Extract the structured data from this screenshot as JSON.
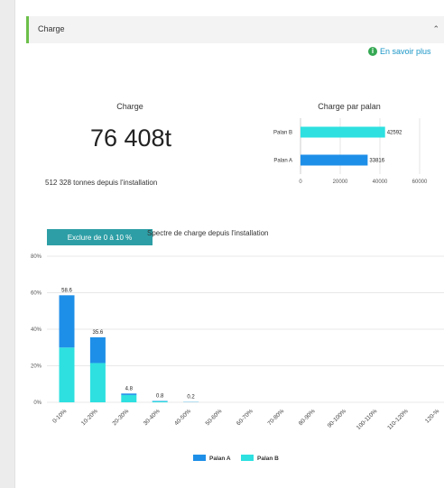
{
  "panel": {
    "title": "Charge"
  },
  "info_link": {
    "label": "En savoir plus"
  },
  "kpi": {
    "title": "Charge",
    "value": "76 408t",
    "subtitle": "512 328 tonnes depuis l'installation"
  },
  "spectrum": {
    "filter_button": "Exclure de 0 à 10 %",
    "title": "Spectre de charge depuis l'installation"
  },
  "colors": {
    "palan_a": "#1e8fe8",
    "palan_b": "#2ee0e0",
    "accent": "#6cc04a",
    "button": "#2d9ea5"
  },
  "chart_data": [
    {
      "type": "bar",
      "orientation": "horizontal",
      "title": "Charge par palan",
      "categories": [
        "Palan B",
        "Palan A"
      ],
      "values": [
        42592,
        33816
      ],
      "data_labels": [
        "42592",
        "33816"
      ],
      "xlim": [
        0,
        60000
      ],
      "x_ticks": [
        "0",
        "20000",
        "40000",
        "60000"
      ],
      "grid": true
    },
    {
      "type": "bar",
      "stacked": true,
      "categories": [
        "0-10%",
        "10-20%",
        "20-30%",
        "30-40%",
        "40-50%",
        "50-60%",
        "60-70%",
        "70-80%",
        "80-90%",
        "90-100%",
        "100-110%",
        "110-120%",
        "120-%"
      ],
      "series": [
        {
          "name": "Palan A",
          "values": [
            28.6,
            14.1,
            0.8,
            0.2,
            0.1,
            0,
            0,
            0,
            0,
            0,
            0,
            0,
            0
          ]
        },
        {
          "name": "Palan B",
          "values": [
            30.0,
            21.5,
            4.0,
            0.6,
            0.1,
            0,
            0,
            0,
            0,
            0,
            0,
            0,
            0
          ]
        }
      ],
      "totals": [
        58.6,
        35.6,
        4.8,
        0.8,
        0.2,
        null,
        null,
        null,
        null,
        null,
        null,
        null,
        null
      ],
      "total_labels": [
        "58.6",
        "35.6",
        "4.8",
        "0.8",
        "0.2"
      ],
      "ylim": [
        0,
        80
      ],
      "y_ticks": [
        "0%",
        "20%",
        "40%",
        "60%",
        "80%"
      ],
      "legend": [
        "Palan A",
        "Palan B"
      ],
      "legend_position": "bottom",
      "grid": true
    }
  ]
}
